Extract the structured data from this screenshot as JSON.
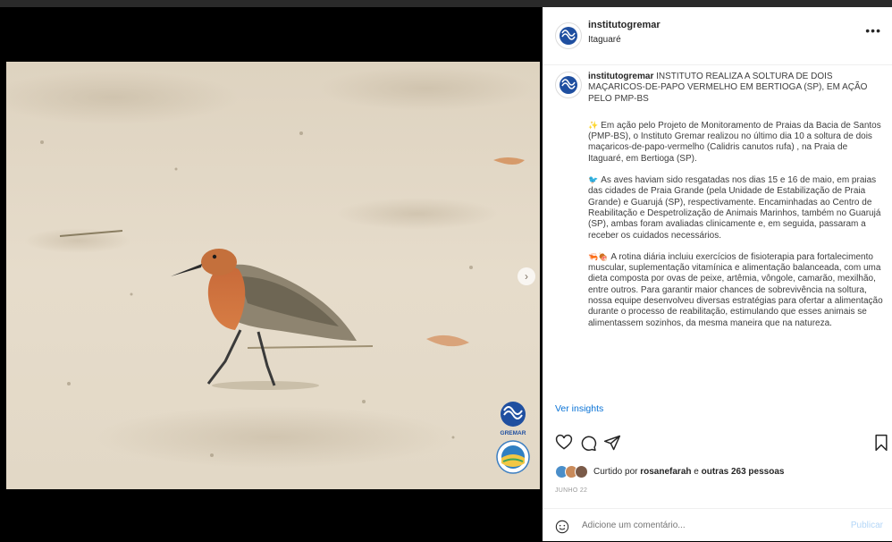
{
  "post": {
    "username": "institutogremar",
    "location": "Itaguaré",
    "more_icon": "more-options-icon"
  },
  "caption": {
    "username": "institutogremar",
    "headline": "INSTITUTO REALIZA A SOLTURA DE DOIS MAÇARICOS-DE-PAPO VERMELHO EM BERTIOGA (SP), EM AÇÃO PELO PMP-BS",
    "p1_emoji": "✨",
    "p1": "Em ação pelo Projeto de Monitoramento de Praias da Bacia de Santos (PMP-BS), o Instituto Gremar realizou no último dia 10 a soltura de dois maçaricos-de-papo-vermelho (Calidris canutos rufa) , na Praia de Itaguaré, em Bertioga (SP).",
    "p2_emoji": "🐦",
    "p2": "As aves haviam sido resgatadas nos dias 15 e 16 de maio, em praias das cidades de Praia Grande (pela Unidade de Estabilização de Praia Grande) e Guarujá (SP), respectivamente. Encaminhadas ao Centro de Reabilitação e Despetrolização de Animais Marinhos, também no Guarujá (SP), ambas foram avaliadas clinicamente e, em seguida, passaram a receber os cuidados necessários.",
    "p3_emoji": "🦐🍖",
    "p3": "A rotina diária incluiu exercícios de fisioterapia para fortalecimento muscular, suplementação vitamínica e alimentação balanceada, com uma dieta composta por ovas de peixe, artêmia, vôngole, camarão, mexilhão, entre outros. Para garantir maior chances de sobrevivência na soltura, nossa equipe desenvolveu diversas estratégias para ofertar a alimentação durante o processo de reabilitação, estimulando que esses animais se alimentassem sozinhos, da mesma maneira que na natureza."
  },
  "insights_label": "Ver insights",
  "likes": {
    "prefix": "Curtido por",
    "user": "rosanefarah",
    "connector": "e",
    "others": "outras 263 pessoas"
  },
  "date": "JUNHO 22",
  "comment": {
    "placeholder": "Adicione um comentário...",
    "publish_label": "Publicar"
  },
  "media": {
    "logo_text": "GREMAR"
  },
  "colors": {
    "link_blue": "#0a73d6",
    "publish_disabled": "#b3d6f7",
    "brand_blue": "#1f4fa0"
  }
}
